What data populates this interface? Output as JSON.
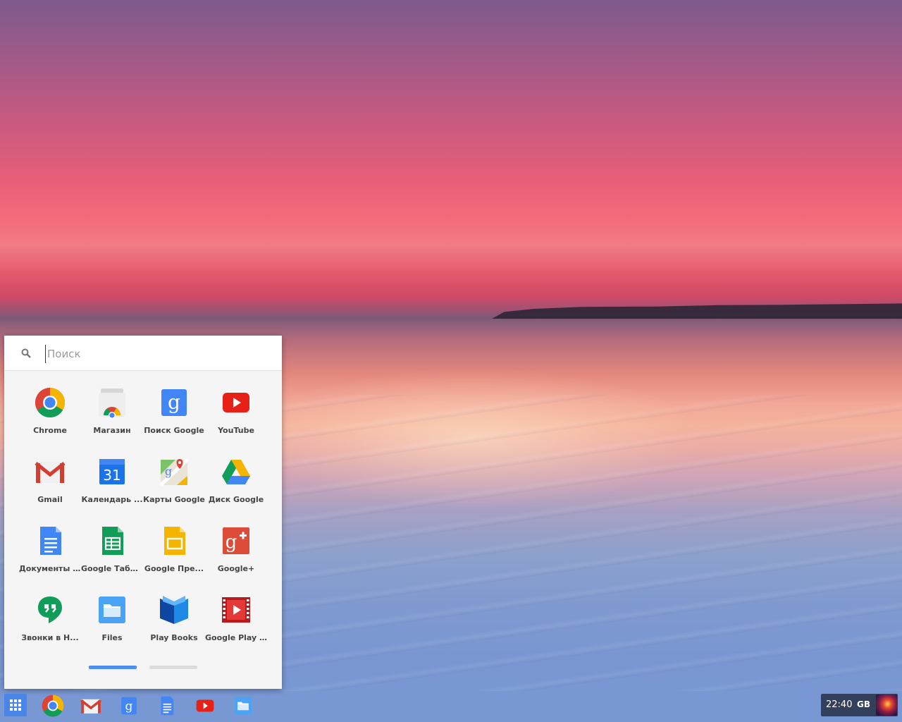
{
  "launcher": {
    "search_placeholder": "Поиск",
    "apps": [
      {
        "label": "Chrome",
        "icon": "chrome-icon"
      },
      {
        "label": "Магазин",
        "icon": "web-store-icon"
      },
      {
        "label": "Поиск Google",
        "icon": "google-search-icon"
      },
      {
        "label": "YouTube",
        "icon": "youtube-icon"
      },
      {
        "label": "Gmail",
        "icon": "gmail-icon"
      },
      {
        "label": "Календарь ...",
        "icon": "calendar-icon"
      },
      {
        "label": "Карты Google",
        "icon": "maps-icon"
      },
      {
        "label": "Диск Google",
        "icon": "drive-icon"
      },
      {
        "label": "Документы ...",
        "icon": "docs-icon"
      },
      {
        "label": "Google Табл...",
        "icon": "sheets-icon"
      },
      {
        "label": "Google Пре...",
        "icon": "slides-icon"
      },
      {
        "label": "Google+",
        "icon": "google-plus-icon"
      },
      {
        "label": "Звонки в Н...",
        "icon": "hangouts-icon"
      },
      {
        "label": "Files",
        "icon": "files-icon"
      },
      {
        "label": "Play Books",
        "icon": "play-books-icon"
      },
      {
        "label": "Google Play ...",
        "icon": "play-movies-icon"
      }
    ],
    "calendar_day": "31",
    "pages": {
      "count": 2,
      "current": 1
    }
  },
  "shelf": {
    "items": [
      "app-launcher-icon",
      "chrome-icon",
      "gmail-icon",
      "google-search-icon",
      "docs-icon",
      "youtube-icon",
      "files-icon"
    ]
  },
  "status": {
    "time": "22:40",
    "keyboard_layout": "GB"
  },
  "colors": {
    "accent": "#4285f4",
    "launcher_bg": "#f5f5f5"
  }
}
